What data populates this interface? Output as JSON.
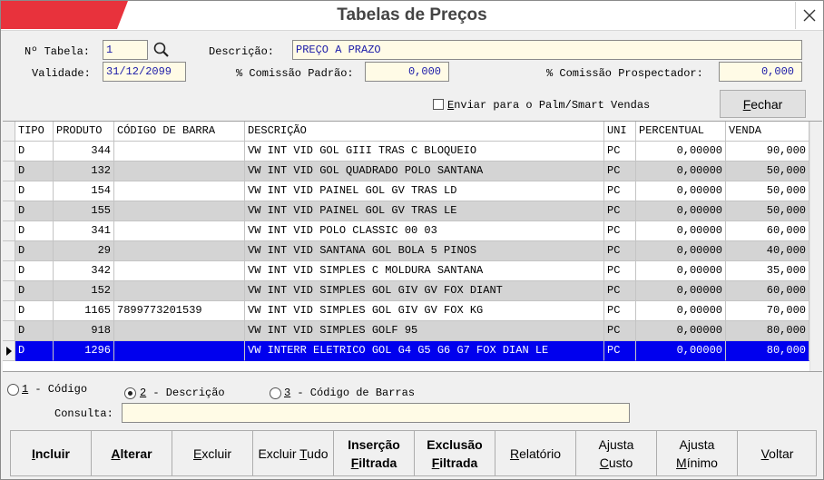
{
  "window": {
    "title": "Tabelas de Preços"
  },
  "header": {
    "tabela_label": "Nº Tabela:",
    "tabela_value": "1",
    "descricao_label": "Descrição:",
    "descricao_value": "PREÇO A PRAZO",
    "validade_label": "Validade:",
    "validade_value": "31/12/2099",
    "comissao_padrao_label": "% Comissão Padrão:",
    "comissao_padrao_value": "0,000",
    "comissao_prospectador_label": "% Comissão Prospectador:",
    "comissao_prospectador_value": "0,000",
    "palm_label_prefix": "E",
    "palm_label_rest": "nviar para o Palm/Smart Vendas",
    "fechar_prefix": "F",
    "fechar_rest": "echar"
  },
  "grid": {
    "columns": [
      "TIPO",
      "PRODUTO",
      "CÓDIGO DE BARRA",
      "DESCRIÇÃO",
      "UNI",
      "PERCENTUAL",
      "VENDA"
    ],
    "rows": [
      [
        "D",
        "344",
        "",
        "VW INT VID GOL GIII TRAS C BLOQUEIO",
        "PC",
        "0,00000",
        "90,000"
      ],
      [
        "D",
        "132",
        "",
        "VW INT VID GOL QUADRADO POLO SANTANA",
        "PC",
        "0,00000",
        "50,000"
      ],
      [
        "D",
        "154",
        "",
        "VW INT VID PAINEL GOL GV TRAS LD",
        "PC",
        "0,00000",
        "50,000"
      ],
      [
        "D",
        "155",
        "",
        "VW INT VID PAINEL GOL GV TRAS LE",
        "PC",
        "0,00000",
        "50,000"
      ],
      [
        "D",
        "341",
        "",
        "VW INT VID POLO CLASSIC 00 03",
        "PC",
        "0,00000",
        "60,000"
      ],
      [
        "D",
        "29",
        "",
        "VW INT VID SANTANA GOL BOLA 5 PINOS",
        "PC",
        "0,00000",
        "40,000"
      ],
      [
        "D",
        "342",
        "",
        "VW INT VID SIMPLES C MOLDURA SANTANA",
        "PC",
        "0,00000",
        "35,000"
      ],
      [
        "D",
        "152",
        "",
        "VW INT VID SIMPLES GOL GIV GV FOX DIANT",
        "PC",
        "0,00000",
        "60,000"
      ],
      [
        "D",
        "1165",
        "7899773201539",
        "VW INT VID SIMPLES GOL GIV GV FOX KG",
        "PC",
        "0,00000",
        "70,000"
      ],
      [
        "D",
        "918",
        "",
        "VW INT VID SIMPLES GOLF 95",
        "PC",
        "0,00000",
        "80,000"
      ],
      [
        "D",
        "1296",
        "",
        "VW INTERR ELETRICO GOL G4 G5 G6 G7 FOX DIAN LE",
        "PC",
        "0,00000",
        "80,000"
      ]
    ],
    "selected_row": 10
  },
  "search": {
    "opt1_num": "1",
    "opt1_text": " - Código",
    "opt2_num": "2",
    "opt2_text": " - Descrição",
    "opt3_num": "3",
    "opt3_text": " - Código de Barras",
    "selected": 2,
    "consulta_label": "Consulta:",
    "consulta_value": ""
  },
  "toolbar": [
    {
      "pre": "",
      "u": "I",
      "post": "ncluir",
      "bold": true
    },
    {
      "pre": "",
      "u": "A",
      "post": "lterar",
      "bold": true
    },
    {
      "pre": "",
      "u": "E",
      "post": "xcluir",
      "bold": false
    },
    {
      "pre": "Excluir ",
      "u": "T",
      "post": "udo",
      "bold": false
    },
    {
      "pre": "Inserção",
      "u": "F",
      "post": "iltrada",
      "bold": true,
      "two": true
    },
    {
      "pre": "Exclusão",
      "u": "F",
      "post": "iltrada",
      "bold": true,
      "two": true,
      "alt": "Fi"
    },
    {
      "pre": "",
      "u": "R",
      "post": "elatório",
      "bold": false
    },
    {
      "pre": "Ajusta",
      "u": "C",
      "post": "usto",
      "bold": false,
      "two": true
    },
    {
      "pre": "Ajusta",
      "u": "M",
      "post": "ínimo",
      "bold": false,
      "two": true
    },
    {
      "pre": "",
      "u": "V",
      "post": "oltar",
      "bold": false
    }
  ],
  "colors": {
    "selection": "#0000ee",
    "field_bg": "#fffbe6",
    "field_text": "#1a1aa8",
    "accent": "#e8323c"
  },
  "icons": {
    "close": "close-icon",
    "search": "search-icon",
    "row_pointer": "row-pointer-icon"
  }
}
